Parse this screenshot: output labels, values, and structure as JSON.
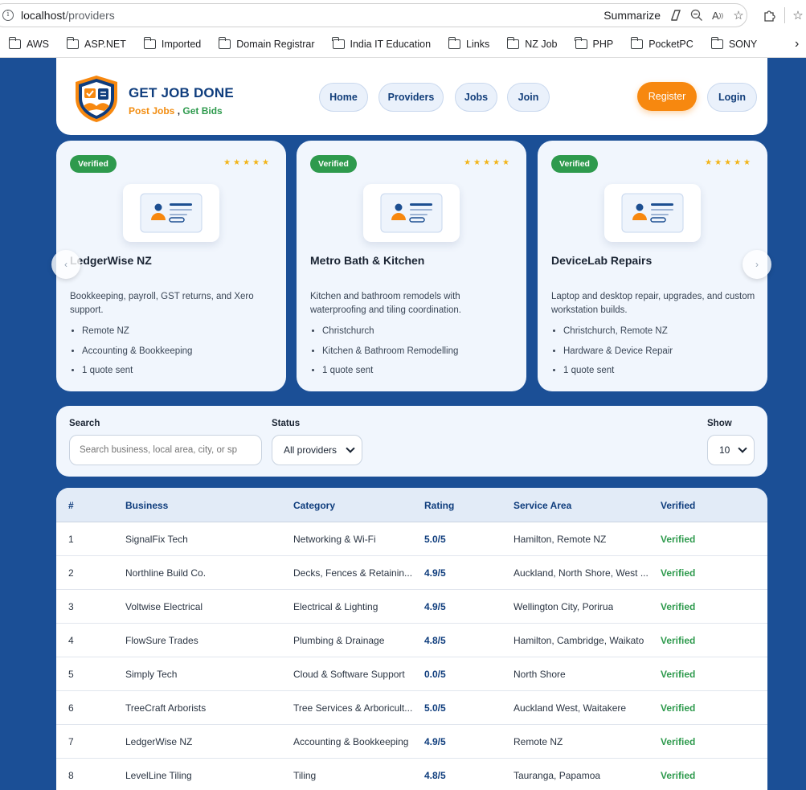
{
  "browser": {
    "url_host": "localhost",
    "url_path": "/providers",
    "summarize_label": "Summarize",
    "bookmarks": [
      "AWS",
      "ASP.NET",
      "Imported",
      "Domain Registrar",
      "India IT Education",
      "Links",
      "NZ Job",
      "PHP",
      "PocketPC",
      "SONY"
    ]
  },
  "header": {
    "brand_title": "GET JOB DONE",
    "tagline_post": "Post Jobs",
    "tagline_sep": " , ",
    "tagline_bids": "Get Bids",
    "nav": [
      "Home",
      "Providers",
      "Jobs",
      "Join"
    ],
    "register_label": "Register",
    "login_label": "Login"
  },
  "featured": [
    {
      "badge": "Verified",
      "stars": "★★★★★",
      "name": "LedgerWise NZ",
      "description": "Bookkeeping, payroll, GST returns, and Xero support.",
      "area": "Remote NZ",
      "category": "Accounting & Bookkeeping",
      "quotes": "1 quote sent"
    },
    {
      "badge": "Verified",
      "stars": "★★★★★",
      "name": "Metro Bath & Kitchen",
      "description": "Kitchen and bathroom remodels with waterproofing and tiling coordination.",
      "area": "Christchurch",
      "category": "Kitchen & Bathroom Remodelling",
      "quotes": "1 quote sent"
    },
    {
      "badge": "Verified",
      "stars": "★★★★★",
      "name": "DeviceLab Repairs",
      "description": "Laptop and desktop repair, upgrades, and custom workstation builds.",
      "area": "Christchurch, Remote NZ",
      "category": "Hardware & Device Repair",
      "quotes": "1 quote sent"
    }
  ],
  "filters": {
    "search_label": "Search",
    "search_placeholder": "Search business, local area, city, or sp",
    "status_label": "Status",
    "status_value": "All providers",
    "show_label": "Show",
    "show_value": "10"
  },
  "table": {
    "headers": [
      "#",
      "Business",
      "Category",
      "Rating",
      "Service Area",
      "Verified"
    ],
    "rows": [
      [
        "1",
        "SignalFix Tech",
        "Networking & Wi-Fi",
        "5.0/5",
        "Hamilton, Remote NZ",
        "Verified"
      ],
      [
        "2",
        "Northline Build Co.",
        "Decks, Fences & Retainin...",
        "4.9/5",
        "Auckland, North Shore, West ...",
        "Verified"
      ],
      [
        "3",
        "Voltwise Electrical",
        "Electrical & Lighting",
        "4.9/5",
        "Wellington City, Porirua",
        "Verified"
      ],
      [
        "4",
        "FlowSure Trades",
        "Plumbing & Drainage",
        "4.8/5",
        "Hamilton, Cambridge, Waikato",
        "Verified"
      ],
      [
        "5",
        "Simply Tech",
        "Cloud & Software Support",
        "0.0/5",
        "North Shore",
        "Verified"
      ],
      [
        "6",
        "TreeCraft Arborists",
        "Tree Services & Arboricult...",
        "5.0/5",
        "Auckland West, Waitakere",
        "Verified"
      ],
      [
        "7",
        "LedgerWise NZ",
        "Accounting & Bookkeeping",
        "4.9/5",
        "Remote NZ",
        "Verified"
      ],
      [
        "8",
        "LevelLine Tiling",
        "Tiling",
        "4.8/5",
        "Tauranga, Papamoa",
        "Verified"
      ]
    ]
  },
  "colors": {
    "page_bg": "#1b4f96",
    "brand_navy": "#0f3d7d",
    "accent_orange": "#f7880f",
    "verified_green": "#2e9a4d"
  }
}
